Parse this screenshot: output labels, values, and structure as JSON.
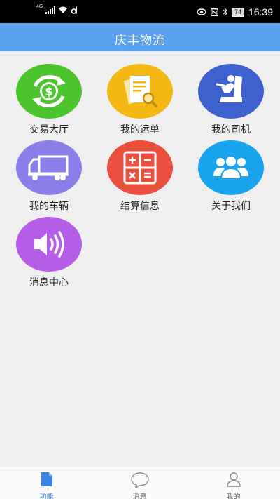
{
  "status_bar": {
    "network": "4G",
    "time": "16:39",
    "battery": "74"
  },
  "header": {
    "title": "庆丰物流"
  },
  "menu": [
    {
      "label": "交易大厅",
      "icon": "money-exchange-icon",
      "color": "#4cc42e"
    },
    {
      "label": "我的运单",
      "icon": "documents-icon",
      "color": "#f4b815"
    },
    {
      "label": "我的司机",
      "icon": "driver-seat-icon",
      "color": "#3d62cf"
    },
    {
      "label": "我的车辆",
      "icon": "truck-icon",
      "color": "#8a7ee8"
    },
    {
      "label": "结算信息",
      "icon": "calculator-icon",
      "color": "#e8503d"
    },
    {
      "label": "关于我们",
      "icon": "group-icon",
      "color": "#1aa3ee"
    },
    {
      "label": "消息中心",
      "icon": "speaker-icon",
      "color": "#b75ee8"
    }
  ],
  "tabs": [
    {
      "label": "功能",
      "icon": "document-icon",
      "active": true
    },
    {
      "label": "消息",
      "icon": "chat-bubble-icon",
      "active": false
    },
    {
      "label": "我的",
      "icon": "person-icon",
      "active": false
    }
  ],
  "colors": {
    "header": "#5aa1ef",
    "active_tab": "#3a86e6",
    "background": "#efefef"
  }
}
